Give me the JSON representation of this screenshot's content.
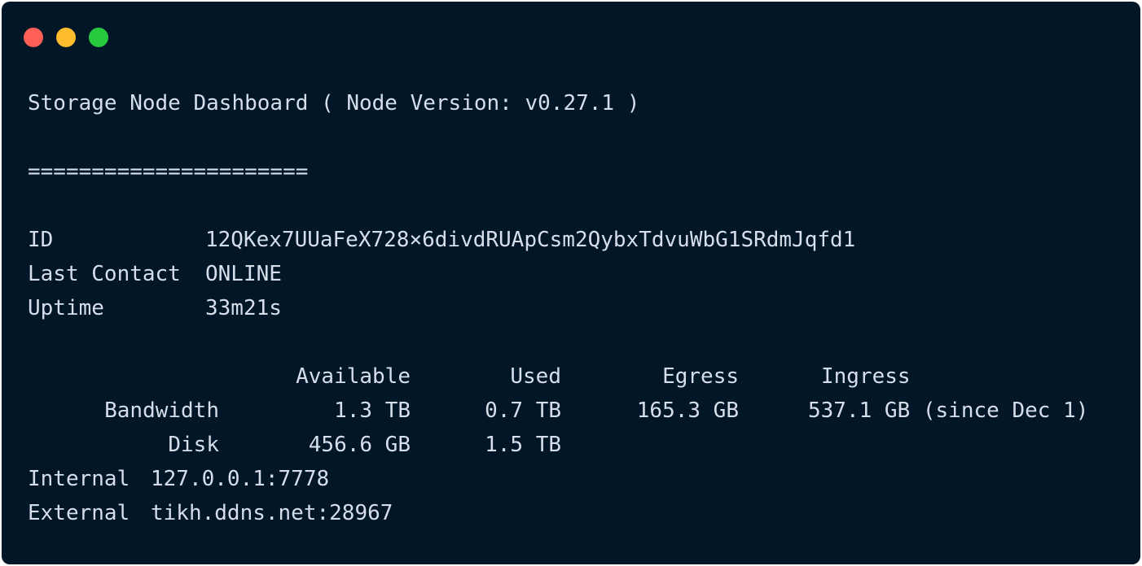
{
  "window": {
    "buttons": [
      "close",
      "minimize",
      "maximize"
    ],
    "colors": {
      "close": "#ff5f56",
      "minimize": "#ffbd2e",
      "maximize": "#27c93f",
      "background": "#011627",
      "text": "#d6deeb"
    }
  },
  "header": {
    "title": "Storage Node Dashboard ( Node Version: v0.27.1 )",
    "separator": "======================"
  },
  "info": {
    "id_label": "ID",
    "id_value": "12QKex7UUaFeX728×6divdRUApCsm2QybxTdvuWbG1SRdmJqfd1",
    "last_contact_label": "Last Contact",
    "last_contact_value": "ONLINE",
    "uptime_label": "Uptime",
    "uptime_value": "33m21s"
  },
  "table": {
    "headers": [
      "Available",
      "Used",
      "Egress",
      "Ingress"
    ],
    "rows": [
      {
        "label": "Bandwidth",
        "available": "1.3 TB",
        "used": "0.7 TB",
        "egress": "165.3 GB",
        "ingress": "537.1 GB (since Dec 1)"
      },
      {
        "label": "Disk",
        "available": "456.6 GB",
        "used": "1.5 TB"
      }
    ]
  },
  "network": {
    "internal_label": "Internal",
    "internal_value": "127.0.0.1:7778",
    "external_label": "External",
    "external_value": "tikh.ddns.net:28967"
  }
}
